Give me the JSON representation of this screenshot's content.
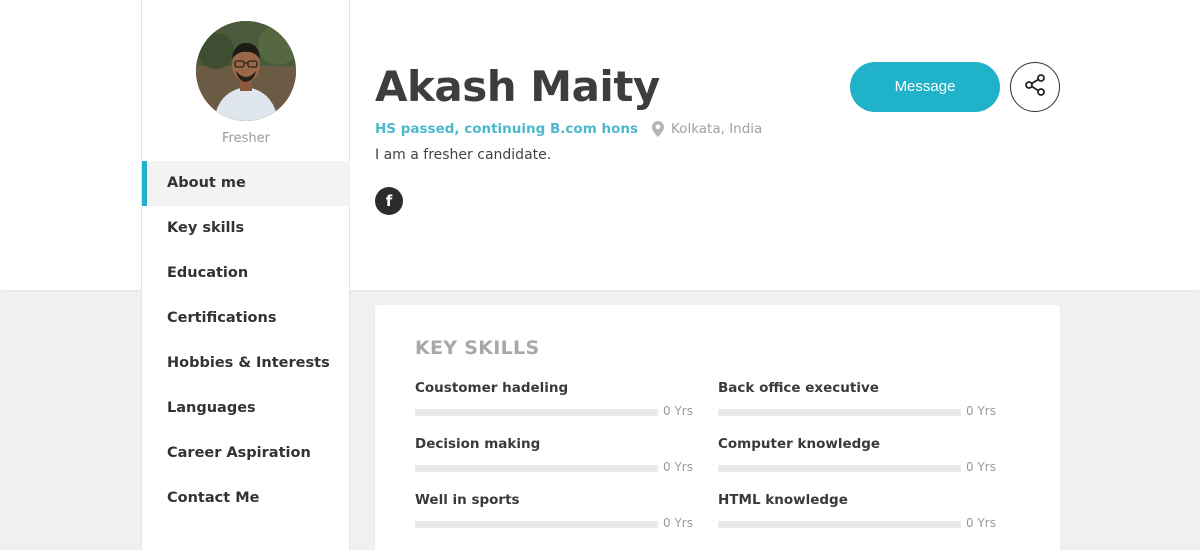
{
  "profile": {
    "name": "Akash Maity",
    "role": "Fresher",
    "education": "HS passed, continuing B.com hons",
    "location": "Kolkata, India",
    "bio": "I am a fresher candidate.",
    "social_facebook_glyph": "f"
  },
  "actions": {
    "message_label": "Message",
    "share_icon": "share-icon"
  },
  "sidebar": {
    "items": [
      {
        "label": "About me",
        "active": true
      },
      {
        "label": "Key skills",
        "active": false
      },
      {
        "label": "Education",
        "active": false
      },
      {
        "label": "Certifications",
        "active": false
      },
      {
        "label": "Hobbies & Interests",
        "active": false
      },
      {
        "label": "Languages",
        "active": false
      },
      {
        "label": "Career Aspiration",
        "active": false
      },
      {
        "label": "Contact Me",
        "active": false
      }
    ]
  },
  "key_skills": {
    "title": "KEY SKILLS",
    "items": [
      {
        "name": "Coustomer hadeling",
        "years": "0 Yrs",
        "level": 0
      },
      {
        "name": "Back office executive",
        "years": "0 Yrs",
        "level": 0
      },
      {
        "name": "Decision making",
        "years": "0 Yrs",
        "level": 0
      },
      {
        "name": "Computer knowledge",
        "years": "0 Yrs",
        "level": 0
      },
      {
        "name": "Well in sports",
        "years": "0 Yrs",
        "level": 0
      },
      {
        "name": "HTML knowledge",
        "years": "0 Yrs",
        "level": 0
      }
    ]
  },
  "colors": {
    "accent": "#1fb2c8",
    "accent_text": "#4db8cc",
    "muted": "#a0a0a0"
  }
}
